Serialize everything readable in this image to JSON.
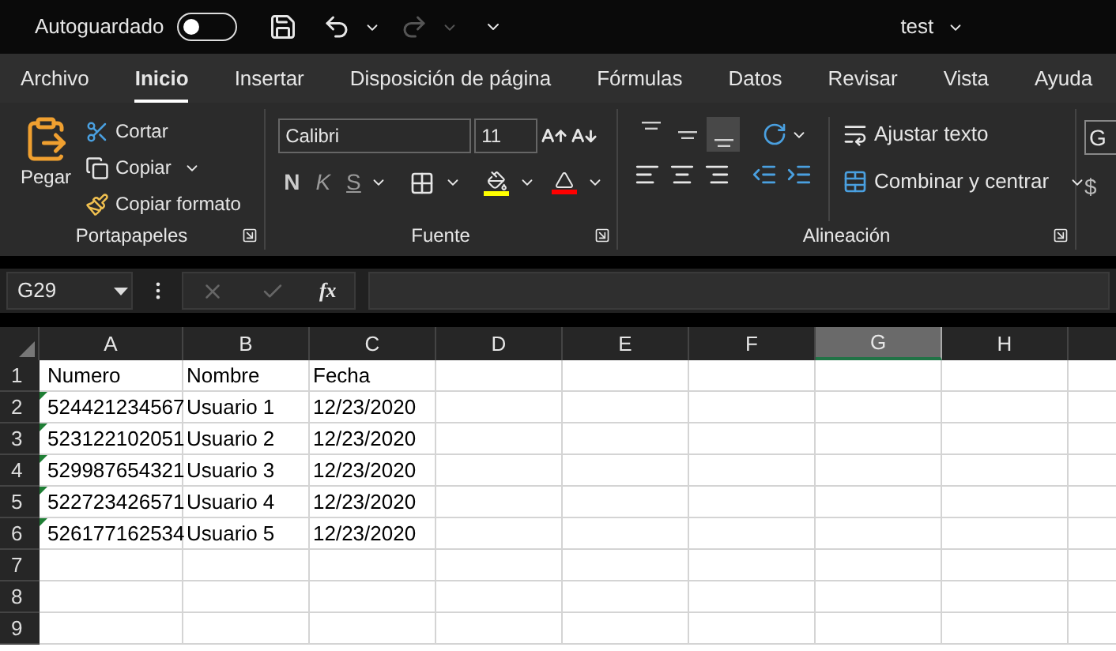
{
  "title_bar": {
    "autosave_label": "Autoguardado",
    "autosave_on": false,
    "title": "test"
  },
  "menu_tabs": [
    {
      "label": "Archivo",
      "selected": false
    },
    {
      "label": "Inicio",
      "selected": true
    },
    {
      "label": "Insertar",
      "selected": false
    },
    {
      "label": "Disposición de página",
      "selected": false
    },
    {
      "label": "Fórmulas",
      "selected": false
    },
    {
      "label": "Datos",
      "selected": false
    },
    {
      "label": "Revisar",
      "selected": false
    },
    {
      "label": "Vista",
      "selected": false
    },
    {
      "label": "Ayuda",
      "selected": false
    }
  ],
  "ribbon": {
    "clipboard": {
      "paste": "Pegar",
      "cut": "Cortar",
      "copy": "Copiar",
      "format_painter": "Copiar formato",
      "group_label": "Portapapeles"
    },
    "font": {
      "font_name": "Calibri",
      "font_size": "11",
      "bold": "N",
      "italic": "K",
      "underline": "S",
      "group_label": "Fuente"
    },
    "alignment": {
      "vertical": [
        {
          "selected": false
        },
        {
          "selected": false
        },
        {
          "selected": true
        }
      ],
      "wrap_text": "Ajustar texto",
      "merge_center": "Combinar y centrar",
      "group_label": "Alineación"
    },
    "number": {
      "format": "G",
      "currency": "$"
    }
  },
  "formula_bar": {
    "name_box": "G29",
    "fx": "fx"
  },
  "sheet": {
    "columns": [
      {
        "label": "A",
        "selected": false
      },
      {
        "label": "B",
        "selected": false
      },
      {
        "label": "C",
        "selected": false
      },
      {
        "label": "D",
        "selected": false
      },
      {
        "label": "E",
        "selected": false
      },
      {
        "label": "F",
        "selected": false
      },
      {
        "label": "G",
        "selected": true
      },
      {
        "label": "H",
        "selected": false
      }
    ],
    "rows": [
      {
        "number": "1",
        "flag": false,
        "cells": [
          "Numero",
          "Nombre",
          "Fecha"
        ]
      },
      {
        "number": "2",
        "flag": true,
        "cells": [
          "524421234567",
          "Usuario 1",
          "12/23/2020"
        ]
      },
      {
        "number": "3",
        "flag": true,
        "cells": [
          "523122102051",
          "Usuario 2",
          "12/23/2020"
        ]
      },
      {
        "number": "4",
        "flag": true,
        "cells": [
          "529987654321",
          "Usuario 3",
          "12/23/2020"
        ]
      },
      {
        "number": "5",
        "flag": true,
        "cells": [
          "522723426571",
          "Usuario 4",
          "12/23/2020"
        ]
      },
      {
        "number": "6",
        "flag": true,
        "cells": [
          "526177162534",
          "Usuario 5",
          "12/23/2020"
        ]
      },
      {
        "number": "7",
        "flag": false,
        "cells": []
      },
      {
        "number": "8",
        "flag": false,
        "cells": []
      },
      {
        "number": "9",
        "flag": false,
        "cells": []
      }
    ]
  }
}
